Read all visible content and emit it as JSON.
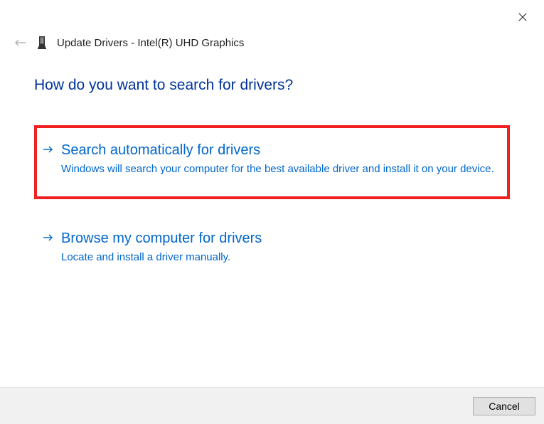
{
  "header": {
    "title": "Update Drivers - Intel(R) UHD Graphics"
  },
  "question": "How do you want to search for drivers?",
  "options": [
    {
      "title": "Search automatically for drivers",
      "desc": "Windows will search your computer for the best available driver and install it on your device."
    },
    {
      "title": "Browse my computer for drivers",
      "desc": "Locate and install a driver manually."
    }
  ],
  "footer": {
    "cancel_label": "Cancel"
  }
}
